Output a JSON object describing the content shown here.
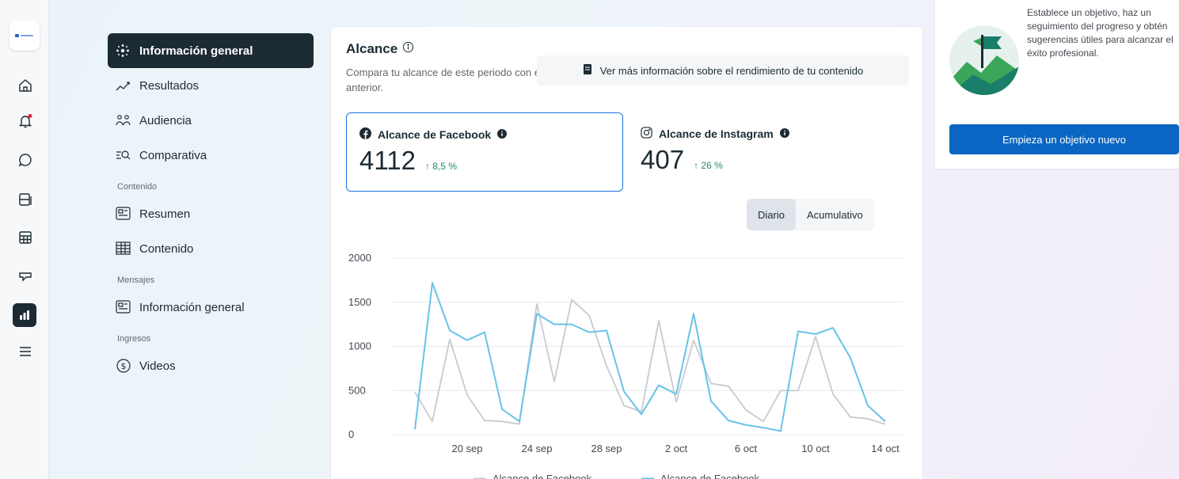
{
  "rail": {
    "logo_icon": "business-logo-icon",
    "icons": [
      "home-icon",
      "bell-icon",
      "chat-icon",
      "posts-icon",
      "table-icon",
      "megaphone-icon",
      "insights-icon",
      "menu-icon"
    ],
    "active_index": 6,
    "notification_color": "#e41e3f"
  },
  "nav": {
    "items": [
      {
        "label": "Información general",
        "icon": "sparkle-icon"
      },
      {
        "label": "Resultados",
        "icon": "trend-icon"
      },
      {
        "label": "Audiencia",
        "icon": "audience-icon"
      },
      {
        "label": "Comparativa",
        "icon": "benchmark-icon"
      }
    ],
    "section_content": "Contenido",
    "content_items": [
      {
        "label": "Resumen",
        "icon": "summary-icon"
      },
      {
        "label": "Contenido",
        "icon": "grid-icon"
      }
    ],
    "section_messages": "Mensajes",
    "messages_items": [
      {
        "label": "Información general",
        "icon": "messages-overview-icon"
      }
    ],
    "section_income": "Ingresos",
    "income_items": [
      {
        "label": "Videos",
        "icon": "dollar-icon"
      }
    ]
  },
  "reach": {
    "title": "Alcance",
    "description": "Compara tu alcance de este periodo con el anterior.",
    "more_button": "Ver más información sobre el rendimiento de tu contenido",
    "facebook": {
      "label": "Alcance de Facebook",
      "value": "4112",
      "change": "↑ 8,5 %"
    },
    "instagram": {
      "label": "Alcance de Instagram",
      "value": "407",
      "change": "↑ 26 %"
    },
    "toggle": {
      "daily": "Diario",
      "cumulative": "Acumulativo",
      "selected": "daily"
    }
  },
  "chart_data": {
    "type": "line",
    "x": [
      "17 sep",
      "18 sep",
      "19 sep",
      "20 sep",
      "21 sep",
      "22 sep",
      "23 sep",
      "24 sep",
      "25 sep",
      "26 sep",
      "27 sep",
      "28 sep",
      "29 sep",
      "30 sep",
      "1 oct",
      "2 oct",
      "3 oct",
      "4 oct",
      "5 oct",
      "6 oct",
      "7 oct",
      "8 oct",
      "9 oct",
      "10 oct",
      "11 oct",
      "12 oct",
      "13 oct",
      "14 oct",
      "15 oct"
    ],
    "x_ticks": [
      "20 sep",
      "24 sep",
      "28 sep",
      "2 oct",
      "6 oct",
      "10 oct",
      "14 oct"
    ],
    "y_ticks": [
      "0",
      "500",
      "1000",
      "1500",
      "2000"
    ],
    "ylim": [
      0,
      2000
    ],
    "grid": true,
    "legend_position": "bottom",
    "series": [
      {
        "name": "Alcance de Facebook",
        "color": "#c6cbd1",
        "values": [
          480,
          150,
          1080,
          450,
          160,
          150,
          120,
          1480,
          600,
          1530,
          1350,
          780,
          330,
          260,
          1290,
          370,
          1070,
          580,
          550,
          280,
          150,
          500,
          500,
          1110,
          460,
          200,
          180,
          120,
          null
        ]
      },
      {
        "name": "Alcance de Facebook",
        "color": "#68c3e8",
        "values": [
          60,
          1720,
          1180,
          1070,
          1160,
          290,
          150,
          1370,
          1250,
          1250,
          1160,
          1180,
          490,
          230,
          560,
          460,
          1370,
          380,
          160,
          110,
          80,
          40,
          1170,
          1140,
          1210,
          870,
          330,
          150,
          null
        ]
      }
    ]
  },
  "goal": {
    "text": "Establece un objetivo, haz un seguimiento del progreso y obtén sugerencias útiles para alcanzar el éxito profesional.",
    "button": "Empieza un objetivo nuevo",
    "illustration_icon": "goal-flag-icon",
    "colors": {
      "teal": "#1a7f6a",
      "green": "#3aa659",
      "sky": "#e6f1ee"
    }
  }
}
